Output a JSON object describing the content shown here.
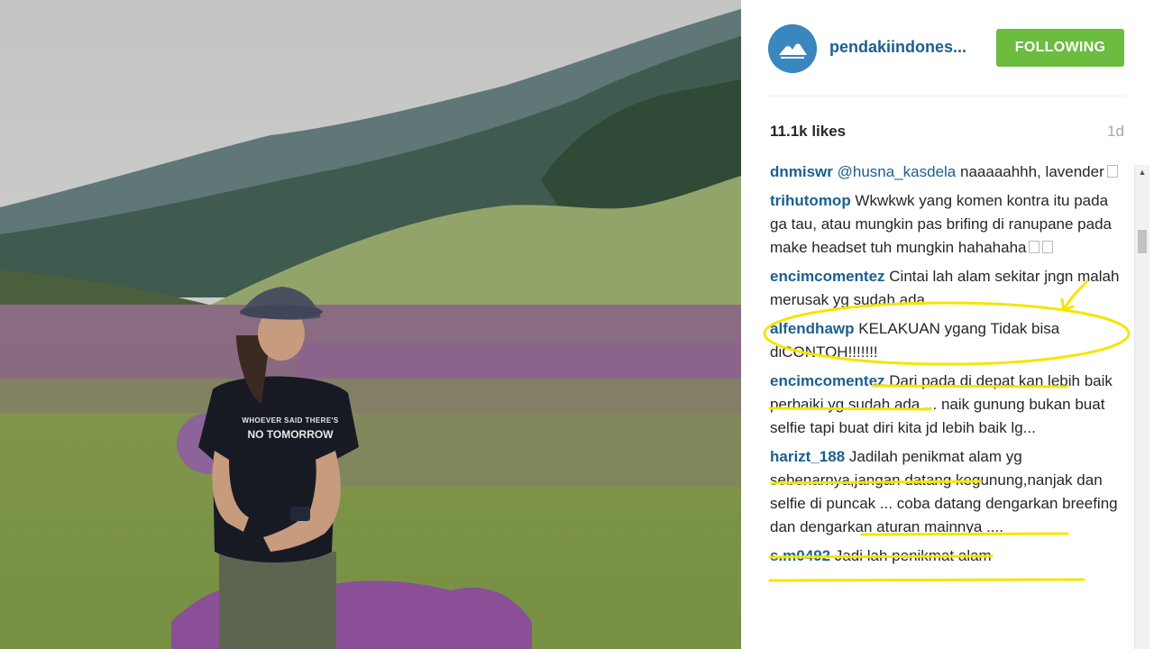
{
  "post": {
    "username": "pendakiindones...",
    "follow_label": "FOLLOWING",
    "likes": "11.1k likes",
    "age": "1d"
  },
  "photo": {
    "shirt_line1": "WHOEVER SAID THERE'S",
    "shirt_line2": "NO TOMORROW"
  },
  "comments": [
    {
      "user": "dnmiswr",
      "mention": "@husna_kasdela",
      "text": " naaaaahhh, lavender"
    },
    {
      "user": "trihutomop",
      "text": " Wkwkwk yang komen kontra itu pada ga tau, atau mungkin pas brifing di ranupane pada make headset tuh mungkin hahahaha"
    },
    {
      "user": "encimcomentez",
      "text": " Cintai lah alam sekitar jngn malah merusak yg sudah ada"
    },
    {
      "user": "alfendhawp",
      "text": " KELAKUAN ygang Tidak bisa diCONTOH!!!!!!!"
    },
    {
      "user": "encimcomentez",
      "text": " Dari pada di depat kan lebih baik perbaiki yg sudah ada ... naik gunung bukan buat selfie tapi buat diri kita jd lebih baik lg..."
    },
    {
      "user": "harizt_188",
      "text": " Jadilah penikmat alam yg sebenarnya,jangan datang kegunung,nanjak dan selfie di puncak ... coba datang dengarkan breefing dan dengarkan aturan mainnya ...."
    },
    {
      "user": "s.m0492",
      "text": " Jadi lah penikmat alam"
    }
  ],
  "colors": {
    "username_blue": "#1c5f8f",
    "follow_green": "#6bbc3f",
    "annotation_yellow": "#f3e600"
  }
}
